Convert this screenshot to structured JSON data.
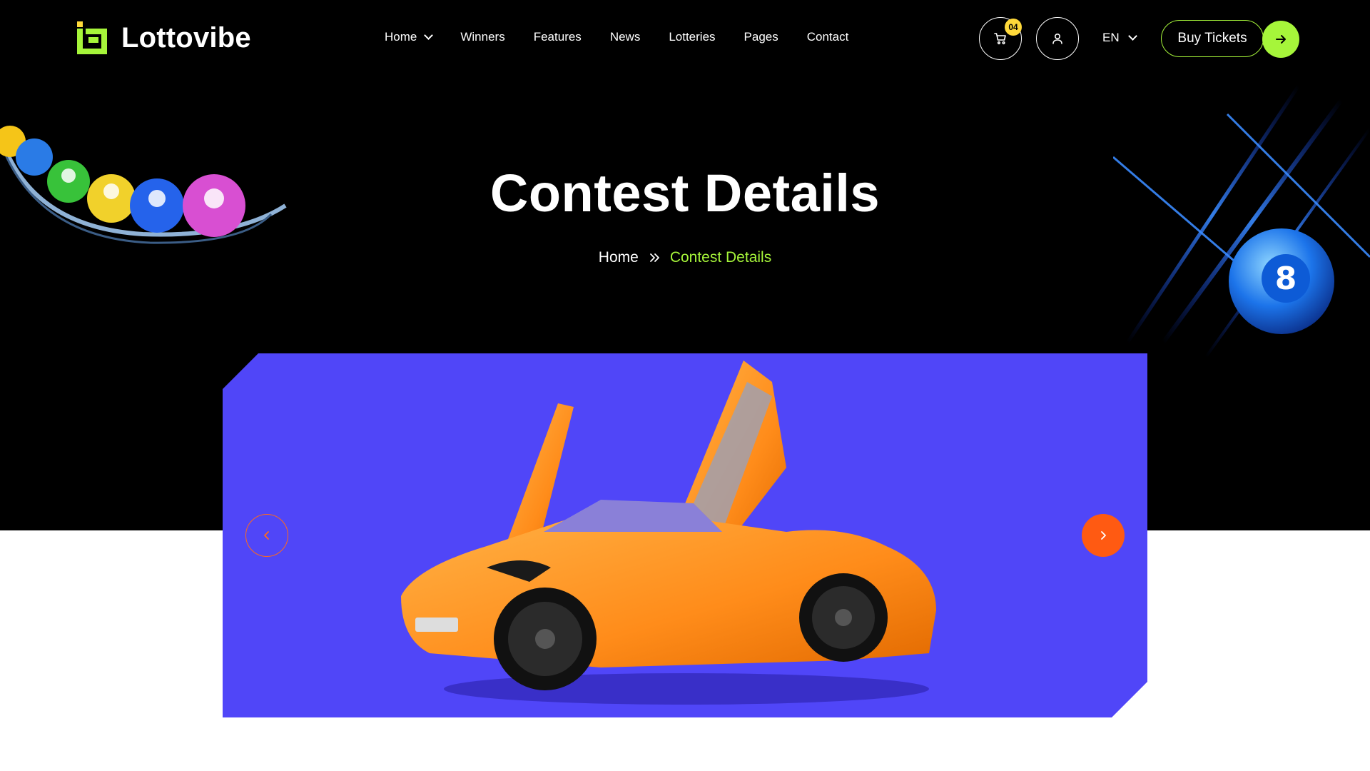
{
  "brand": {
    "name": "Lottovibe"
  },
  "nav": [
    {
      "label": "Home",
      "has_dropdown": true
    },
    {
      "label": "Winners"
    },
    {
      "label": "Features"
    },
    {
      "label": "News"
    },
    {
      "label": "Lotteries"
    },
    {
      "label": "Pages"
    },
    {
      "label": "Contact"
    }
  ],
  "cart": {
    "count": "04",
    "icon": "cart-icon"
  },
  "user": {
    "icon": "user-icon"
  },
  "language": {
    "selected": "EN"
  },
  "cta": {
    "label": "Buy Tickets",
    "icon": "arrow-right-icon"
  },
  "hero": {
    "title": "Contest Details",
    "breadcrumb": {
      "home": "Home",
      "separator_icon": "double-chevron-right-icon",
      "current": "Contest Details"
    }
  },
  "slider": {
    "prev_icon": "chevron-left-icon",
    "next_icon": "chevron-right-icon"
  },
  "colors": {
    "accent": "#a6f53a",
    "badge": "#ffd93a",
    "slider_bg": "#5046f8",
    "slider_button": "#ff5a12",
    "hero_bg": "#000000"
  }
}
